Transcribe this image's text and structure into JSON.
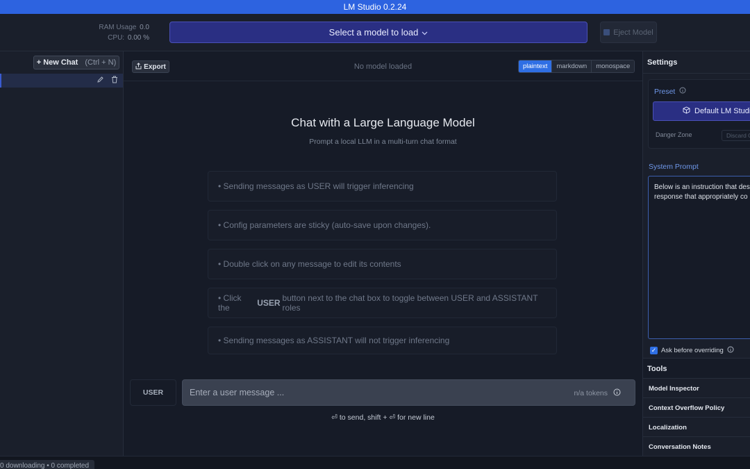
{
  "app": {
    "title": "LM Studio 0.2.24"
  },
  "topbar": {
    "ram_label": "RAM Usage",
    "ram_value": "0.0",
    "cpu_label": "CPU:",
    "cpu_value": "0.00 %",
    "model_select_label": "Select a model to load",
    "eject_label": "Eject Model"
  },
  "sidebar": {
    "new_chat_label": "+ New Chat",
    "new_chat_shortcut": "(Ctrl + N)"
  },
  "main": {
    "export_label": "Export",
    "status": "No model loaded",
    "formats": [
      "plaintext",
      "markdown",
      "monospace"
    ],
    "active_format": "plaintext",
    "hero_title": "Chat with a Large Language Model",
    "hero_subtitle": "Prompt a local LLM in a multi-turn chat format",
    "tips": {
      "tip1": "• Sending messages as USER will trigger inferencing",
      "tip2": "• Config parameters are sticky (auto-save upon changes).",
      "tip3": "• Double click on any message to edit its contents",
      "tip4_pre": "• Click the",
      "tip4_bold": "USER",
      "tip4_post": "button next to the chat box to toggle between USER and ASSISTANT roles",
      "tip5": "• Sending messages as ASSISTANT will not trigger inferencing"
    },
    "role_label": "USER",
    "message_placeholder": "Enter a user message ...",
    "tokens_label": "n/a tokens",
    "send_hint": "⏎ to send, shift + ⏎ for new line"
  },
  "settings": {
    "title": "Settings",
    "preset_label": "Preset",
    "preset_value": "Default LM Studio",
    "danger_zone_label": "Danger Zone",
    "discard_label": "Discard Cha",
    "system_prompt_label": "System Prompt",
    "system_prompt_line1": "Below is an instruction that des",
    "system_prompt_line2": "response that appropriately co",
    "ask_before_overriding": "Ask before overriding",
    "ask_checked": true,
    "tools_title": "Tools",
    "tools": {
      "model_inspector": "Model Inspector",
      "context_overflow": "Context Overflow Policy",
      "localization": "Localization",
      "conversation_notes": "Conversation Notes"
    }
  },
  "statusbar": {
    "downloads": "0 downloading • 0 completed"
  },
  "colors": {
    "accent": "#2f6fe4",
    "model_select_bg": "#2a2f83",
    "titlebar": "#2d63e0"
  }
}
